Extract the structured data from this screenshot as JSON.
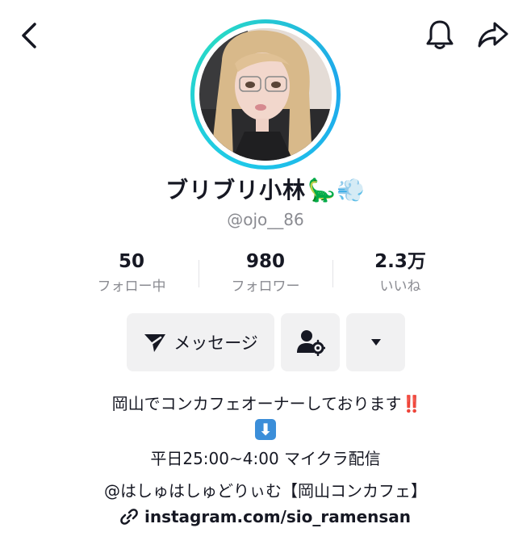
{
  "topbar": {
    "back_icon": "chevron-left-icon",
    "bell_icon": "bell-icon",
    "share_icon": "share-arrow-icon"
  },
  "profile": {
    "name": "ブリブリ小林",
    "name_emojis": "🦕💨",
    "handle": "@ojo__86",
    "avatar_ring_colors": [
      "#1ec9e8",
      "#28d9c6",
      "#1ea7ec"
    ]
  },
  "stats": [
    {
      "value": "50",
      "label": "フォロー中"
    },
    {
      "value": "980",
      "label": "フォロワー"
    },
    {
      "value": "2.3万",
      "label": "いいね"
    }
  ],
  "actions": {
    "message_label": "メッセージ",
    "message_icon": "send-icon",
    "person_icon": "person-settings-icon",
    "more_icon": "caret-down-icon"
  },
  "bio": {
    "line1": "岡山でコンカフェオーナーしております",
    "line1_emoji": "‼️",
    "line2_emoji": "⬇",
    "line3": "平日25:00~4:00 マイクラ配信",
    "line4": "@はしゅはしゅどりぃむ【岡山コンカフェ】",
    "link": "instagram.com/sio_ramensan",
    "link_icon": "link-icon"
  }
}
